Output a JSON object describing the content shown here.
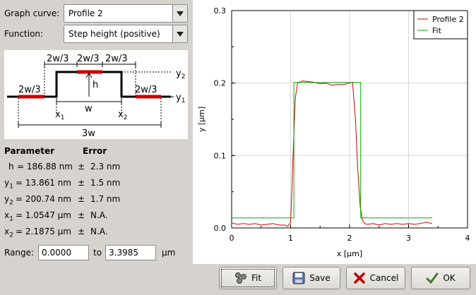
{
  "controls": {
    "graph_curve_label": "Graph curve:",
    "graph_curve_value": "Profile 2",
    "function_label": "Function:",
    "function_value": "Step height (positive)"
  },
  "diagram": {
    "seg_top": "2w/3",
    "seg_left": "2w/3",
    "seg_right": "2w/3",
    "seg_base_left": "2w/3",
    "seg_base_right": "2w/3",
    "h": "h",
    "w": "w",
    "x1": "x",
    "x1_sub": "1",
    "x2": "x",
    "x2_sub": "2",
    "y1": "y",
    "y1_sub": "1",
    "y2": "y",
    "y2_sub": "2",
    "total": "3w"
  },
  "results": {
    "param_header": "Parameter",
    "error_header": "Error",
    "rows": [
      {
        "name": "h",
        "sub": "",
        "value": "= 186.88 nm",
        "pm": "±",
        "error": "2.3 nm"
      },
      {
        "name": "y",
        "sub": "1",
        "value": "= 13.861 nm",
        "pm": "±",
        "error": "1.5 nm"
      },
      {
        "name": "y",
        "sub": "2",
        "value": "= 200.74 nm",
        "pm": "±",
        "error": "1.7 nm"
      },
      {
        "name": "x",
        "sub": "1",
        "value": "= 1.0547 µm",
        "pm": "±",
        "error": "N.A."
      },
      {
        "name": "x",
        "sub": "2",
        "value": "= 2.1875 µm",
        "pm": "±",
        "error": "N.A."
      }
    ]
  },
  "range": {
    "label": "Range:",
    "from": "0.0000",
    "to_label": "to",
    "to": "3.3985",
    "unit": "µm"
  },
  "chart_data": {
    "type": "line",
    "xlabel": "x [µm]",
    "ylabel": "y [µm]",
    "xlim": [
      0,
      4
    ],
    "ylim": [
      0,
      0.3
    ],
    "x_ticks": [
      "0",
      "1",
      "2",
      "3",
      "4"
    ],
    "y_ticks": [
      "0.0",
      "0.1",
      "0.2",
      "0.3"
    ],
    "grid": true,
    "legend_position": "top-right",
    "series": [
      {
        "name": "Profile 2",
        "color": "#d00000",
        "x": [
          0.0,
          0.1,
          0.2,
          0.3,
          0.4,
          0.5,
          0.6,
          0.7,
          0.8,
          0.9,
          0.95,
          1.0,
          1.02,
          1.05,
          1.08,
          1.12,
          1.2,
          1.3,
          1.4,
          1.5,
          1.6,
          1.7,
          1.8,
          1.9,
          2.0,
          2.05,
          2.1,
          2.14,
          2.18,
          2.22,
          2.26,
          2.3,
          2.4,
          2.5,
          2.6,
          2.7,
          2.8,
          2.9,
          3.0,
          3.1,
          3.2,
          3.3,
          3.4
        ],
        "y": [
          0.007,
          0.005,
          0.006,
          0.005,
          0.006,
          0.004,
          0.005,
          0.006,
          0.004,
          0.004,
          0.002,
          0.008,
          0.05,
          0.12,
          0.18,
          0.2,
          0.203,
          0.202,
          0.201,
          0.199,
          0.2,
          0.197,
          0.198,
          0.198,
          0.2,
          0.201,
          0.15,
          0.08,
          0.03,
          0.01,
          0.006,
          0.005,
          0.006,
          0.004,
          0.006,
          0.005,
          0.006,
          0.005,
          0.006,
          0.005,
          0.006,
          0.008,
          0.006
        ]
      },
      {
        "name": "Fit",
        "color": "#00b000",
        "x": [
          0.0,
          1.0547,
          1.0547,
          2.1875,
          2.1875,
          3.3985
        ],
        "y": [
          0.013861,
          0.013861,
          0.20074,
          0.20074,
          0.013861,
          0.013861
        ]
      }
    ]
  },
  "buttons": {
    "fit": "Fit",
    "save": "Save",
    "cancel": "Cancel",
    "ok": "OK"
  }
}
